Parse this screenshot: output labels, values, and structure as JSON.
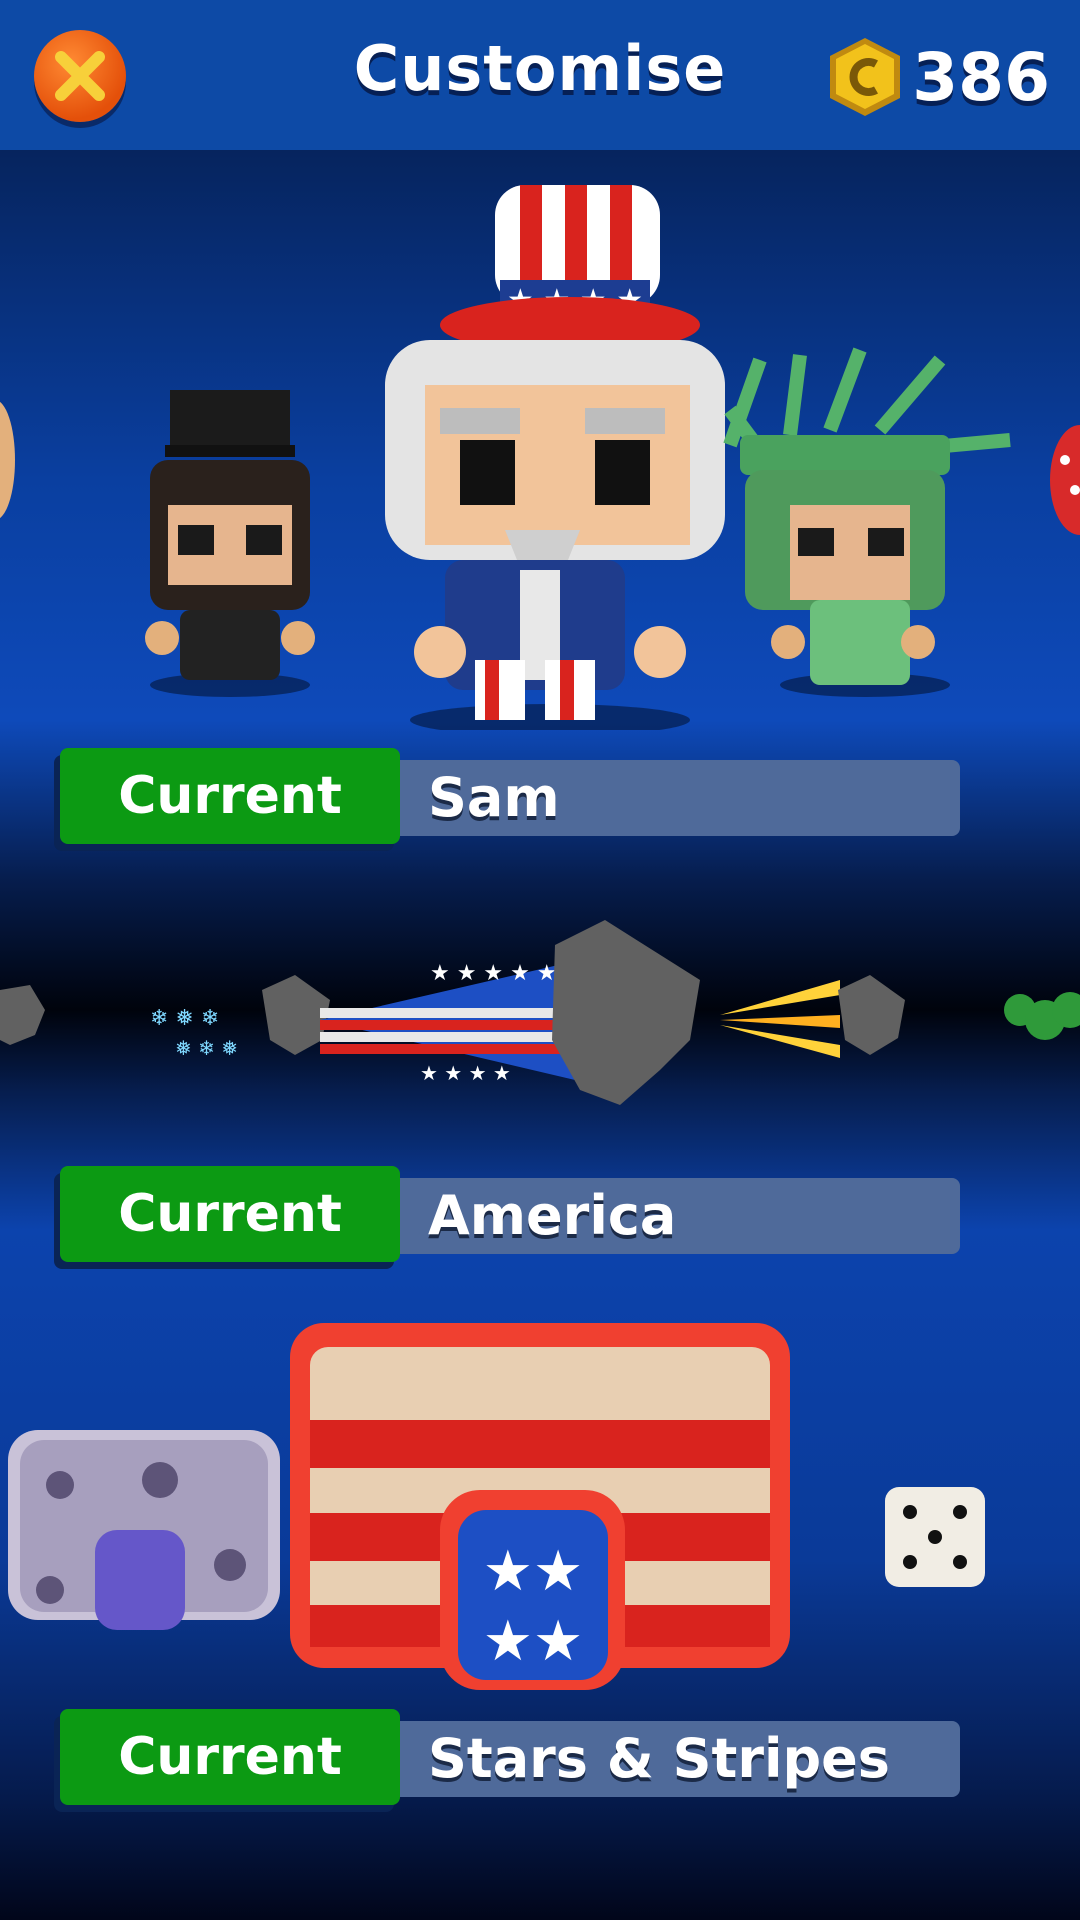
{
  "header": {
    "title": "Customise",
    "coins": "386"
  },
  "rows": [
    {
      "button_label": "Current",
      "selected_name": "Sam"
    },
    {
      "button_label": "Current",
      "selected_name": "America"
    },
    {
      "button_label": "Current",
      "selected_name": "Stars & Stripes"
    }
  ],
  "icons": {
    "close": "close-icon",
    "coin": "coin-icon",
    "dice": "dice-icon"
  },
  "colors": {
    "header": "#0d4aa6",
    "current_button": "#0c9a13",
    "name_plate": "#4f6a9a",
    "close_button": "#ff6a1a",
    "coin": "#f2c21b"
  }
}
